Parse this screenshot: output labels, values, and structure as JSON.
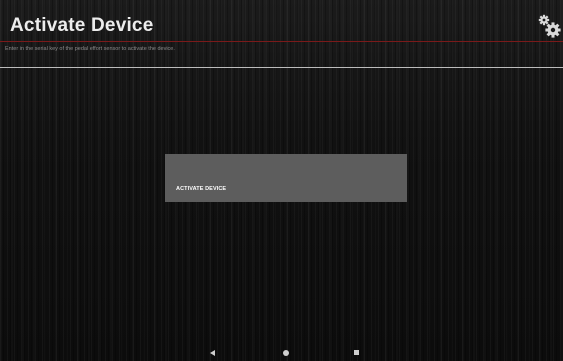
{
  "app_bar": {
    "title": "Activate Device",
    "settings_icon": "gear-icon"
  },
  "instructions": {
    "text": "Enter in the serial key of the pedal effort sensor to activate the device."
  },
  "main": {
    "activate_button_label": "ACTIVATE DEVICE",
    "activate_button_color": "#5d5d5d"
  },
  "nav_bar": {
    "back_icon": "back-triangle-icon",
    "home_icon": "home-circle-icon",
    "recents_icon": "recents-square-icon"
  },
  "colors": {
    "divider_accent": "#7a1a1a",
    "divider_light": "#bcbcbc",
    "background": "#111111"
  }
}
